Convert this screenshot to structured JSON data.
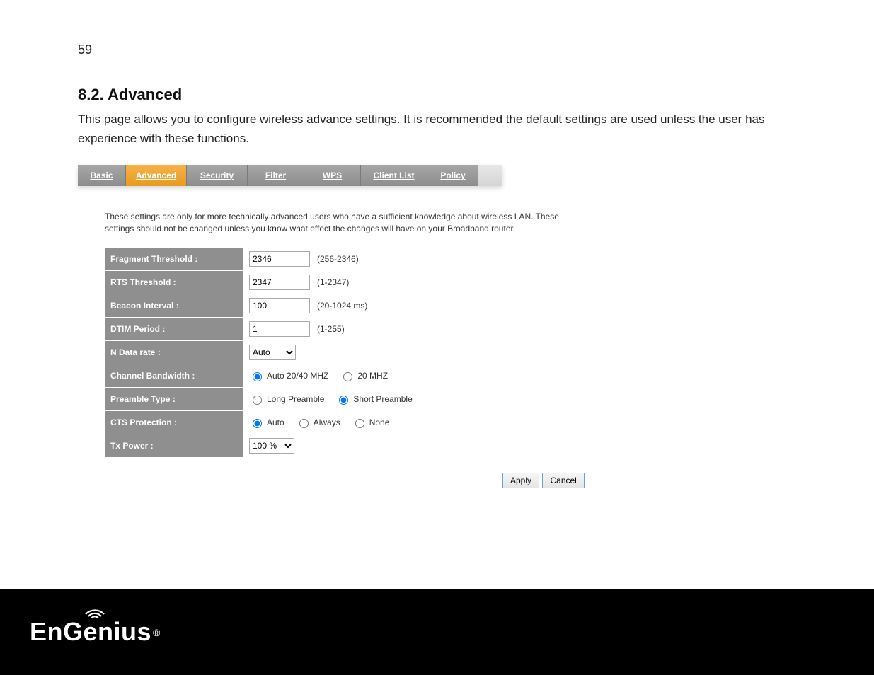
{
  "page_number": "59",
  "heading": "8.2. Advanced",
  "intro": "This page allows you to configure wireless advance settings. It is recommended the default settings are used unless the user has experience with these functions.",
  "tabs": {
    "basic": "Basic",
    "advanced": "Advanced",
    "security": "Security",
    "filter": "Filter",
    "wps": "WPS",
    "client_list": "Client List",
    "policy": "Policy"
  },
  "warning": "These settings are only for more technically advanced users who have a sufficient knowledge about wireless LAN. These settings should not be changed unless you know what effect the changes will have on your Broadband router.",
  "fields": {
    "fragment": {
      "label": "Fragment Threshold :",
      "value": "2346",
      "hint": "(256-2346)"
    },
    "rts": {
      "label": "RTS Threshold :",
      "value": "2347",
      "hint": "(1-2347)"
    },
    "beacon": {
      "label": "Beacon Interval :",
      "value": "100",
      "hint": "(20-1024 ms)"
    },
    "dtim": {
      "label": "DTIM Period :",
      "value": "1",
      "hint": "(1-255)"
    },
    "ndata": {
      "label": "N Data rate :",
      "value": "Auto"
    },
    "chbw": {
      "label": "Channel Bandwidth :",
      "opt1": "Auto 20/40 MHZ",
      "opt2": "20 MHZ"
    },
    "preamble": {
      "label": "Preamble Type :",
      "opt1": "Long Preamble",
      "opt2": "Short Preamble"
    },
    "cts": {
      "label": "CTS Protection :",
      "opt1": "Auto",
      "opt2": "Always",
      "opt3": "None"
    },
    "txpower": {
      "label": "Tx Power :",
      "value": "100 %"
    }
  },
  "buttons": {
    "apply": "Apply",
    "cancel": "Cancel"
  },
  "logo": {
    "text": "EnGenius",
    "reg": "®"
  }
}
